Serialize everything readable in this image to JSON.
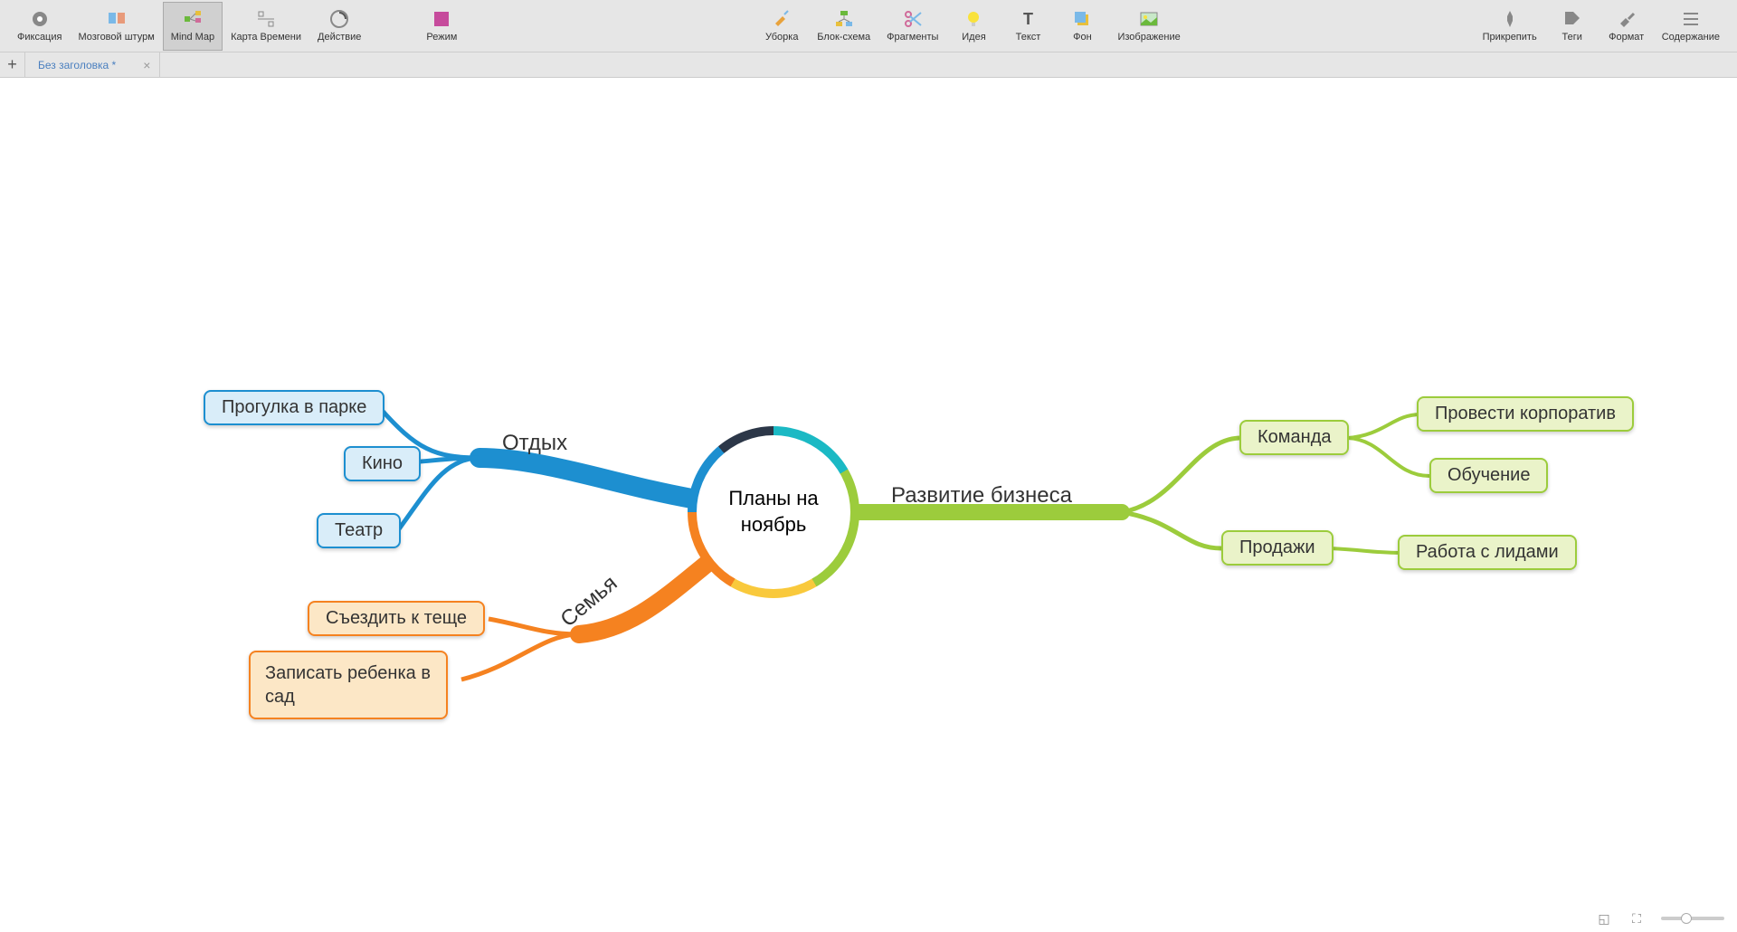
{
  "toolbar": {
    "left": [
      {
        "id": "fix",
        "label": "Фиксация"
      },
      {
        "id": "brainstorm",
        "label": "Мозговой штурм"
      },
      {
        "id": "mindmap",
        "label": "Mind Map",
        "active": true
      },
      {
        "id": "timemap",
        "label": "Карта Времени"
      },
      {
        "id": "action",
        "label": "Действие"
      },
      {
        "id": "mode",
        "label": "Режим"
      }
    ],
    "center": [
      {
        "id": "cleanup",
        "label": "Уборка"
      },
      {
        "id": "blockscheme",
        "label": "Блок-схема"
      },
      {
        "id": "fragments",
        "label": "Фрагменты"
      },
      {
        "id": "idea",
        "label": "Идея"
      },
      {
        "id": "text",
        "label": "Текст"
      },
      {
        "id": "background",
        "label": "Фон"
      },
      {
        "id": "image",
        "label": "Изображение"
      }
    ],
    "right": [
      {
        "id": "attach",
        "label": "Прикрепить"
      },
      {
        "id": "tags",
        "label": "Теги"
      },
      {
        "id": "format",
        "label": "Формат"
      },
      {
        "id": "content",
        "label": "Содержание"
      }
    ]
  },
  "tabs": {
    "tab_title": "Без заголовка *"
  },
  "mindmap": {
    "center": "Планы на\nноябрь",
    "branches": {
      "rest": {
        "label": "Отдых",
        "color": "#1d8fd0"
      },
      "family": {
        "label": "Семья",
        "color": "#f58220"
      },
      "biz": {
        "label": "Развитие бизнеса",
        "color": "#9ccc3c"
      }
    },
    "nodes": {
      "park": "Прогулка в парке",
      "cinema": "Кино",
      "theatre": "Театр",
      "motherinlaw": "Съездить к теще",
      "kindergarten": "Записать ребенка в сад",
      "team": "Команда",
      "sales": "Продажи",
      "party": "Провести корпоратив",
      "training": "Обучение",
      "leads": "Работа с лидами"
    },
    "ring_colors": {
      "top": "#1bb9c4",
      "right": "#9ccc3c",
      "bottomright": "#f9c93c",
      "bottom": "#f58220",
      "left": "#1d8fd0",
      "topleft": "#2c3748"
    }
  }
}
